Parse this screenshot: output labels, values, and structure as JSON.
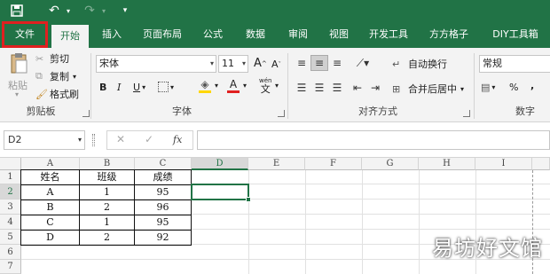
{
  "qat": {
    "save_icon": "save-icon",
    "undo_icon": "undo-icon",
    "redo_icon": "redo-icon",
    "customize_icon": "chevron-down-icon"
  },
  "tabs": [
    "文件",
    "开始",
    "插入",
    "页面布局",
    "公式",
    "数据",
    "审阅",
    "视图",
    "开发工具",
    "方方格子",
    "DIY工具箱"
  ],
  "ribbon": {
    "clipboard": {
      "paste": "粘贴",
      "cut": "剪切",
      "copy": "复制",
      "format_painter": "格式刷",
      "label": "剪贴板"
    },
    "font": {
      "name": "宋体",
      "size": "11",
      "bold": "B",
      "italic": "I",
      "underline": "U",
      "grow": "A",
      "shrink": "A",
      "font_color_letter": "A",
      "wen": "wén",
      "wen_char": "文",
      "label": "字体",
      "accent_yellow": "#ffd700",
      "accent_red": "#e02020"
    },
    "alignment": {
      "wrap_text": "自动换行",
      "merge_center": "合并后居中",
      "label": "对齐方式"
    },
    "number": {
      "format": "常规",
      "percent": "%",
      "comma": ",",
      "label": "数字",
      "currency_icon": "currency-icon"
    }
  },
  "formula_bar": {
    "name_box": "D2",
    "cancel": "✕",
    "enter": "✓",
    "fx": "fx",
    "value": ""
  },
  "grid": {
    "columns": [
      "A",
      "B",
      "C",
      "D",
      "E",
      "F",
      "G",
      "H",
      "I"
    ],
    "rows": [
      "1",
      "2",
      "3",
      "4",
      "5",
      "6",
      "7"
    ],
    "selected_cell": "D2",
    "data": [
      [
        "姓名",
        "班级",
        "成绩"
      ],
      [
        "A",
        "1",
        "95"
      ],
      [
        "B",
        "2",
        "96"
      ],
      [
        "C",
        "1",
        "95"
      ],
      [
        "D",
        "2",
        "92"
      ]
    ]
  },
  "watermark": "易坊好文馆",
  "colors": {
    "brand": "#217346",
    "highlight_border": "#e02020"
  }
}
